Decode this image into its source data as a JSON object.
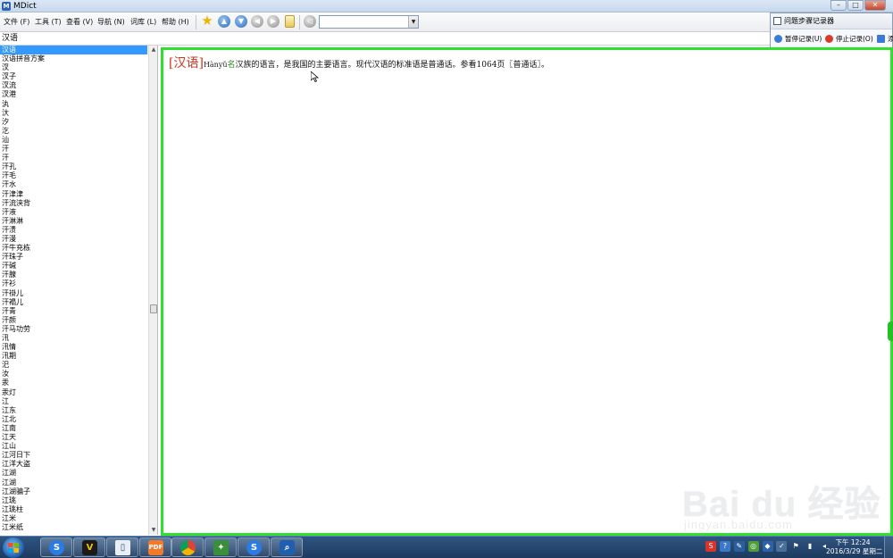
{
  "window": {
    "title": "MDict"
  },
  "menu": [
    {
      "label": "文件 (F)"
    },
    {
      "label": "工具 (T)"
    },
    {
      "label": "查看 (V)"
    },
    {
      "label": "导航 (N)"
    },
    {
      "label": "词库 (L)"
    },
    {
      "label": "帮助 (H)"
    }
  ],
  "toolbar": {
    "icons": [
      "favorite-star-icon",
      "arrow-up-icon",
      "arrow-down-icon",
      "back-icon",
      "forward-icon",
      "document-icon",
      "speaker-icon"
    ],
    "dictionary_select_value": ""
  },
  "recorder": {
    "title": "问题步骤记录器",
    "pause_label": "暂停记录(U)",
    "stop_label": "停止记录(O)",
    "add_label": "添"
  },
  "search": {
    "value": "汉语"
  },
  "wordlist": {
    "selected_index": 0,
    "items": [
      "汉语",
      "汉语拼音方案",
      "汊",
      "汊子",
      "汊流",
      "汊港",
      "汍",
      "汏",
      "汐",
      "汔",
      "汕",
      "汗",
      "汗",
      "汗孔",
      "汗毛",
      "汗水",
      "汗津津",
      "汗流浃背",
      "汗液",
      "汗淋淋",
      "汗渍",
      "汗漫",
      "汗牛充栋",
      "汗珠子",
      "汗碱",
      "汗腺",
      "汗衫",
      "汗褂儿",
      "汗褟儿",
      "汗青",
      "汗颜",
      "汗马功劳",
      "汛",
      "汛情",
      "汛期",
      "汜",
      "汝",
      "汞",
      "汞灯",
      "江",
      "江东",
      "江北",
      "江南",
      "江天",
      "江山",
      "江河日下",
      "江洋大盗",
      "江湖",
      "江湖",
      "江湖骗子",
      "江珧",
      "江珧柱",
      "江米",
      "江米纸"
    ]
  },
  "entry": {
    "headword": "[汉语]",
    "pinyin": "Hànyǔ",
    "pos": "名",
    "definition": "汉族的语言，是我国的主要语言。现代汉语的标准语是普通话。参看1064页〖普通话〗。"
  },
  "watermark": {
    "brand": "Bai du 经验",
    "url": "jingyan.baidu.com"
  },
  "taskbar": {
    "apps": [
      "sogou-browser-icon",
      "shield-app-icon",
      "window-app-icon",
      "pdf-app-icon",
      "chrome-icon",
      "game-app-icon",
      "sogou-app-icon",
      "mdict-app-icon"
    ],
    "clock_time": "下午 12:24",
    "clock_date": "2016/3/29 星期二"
  },
  "colors": {
    "accent_green": "#2fe02f",
    "headword_red": "#d4321d",
    "selection_blue": "#3399ff"
  }
}
